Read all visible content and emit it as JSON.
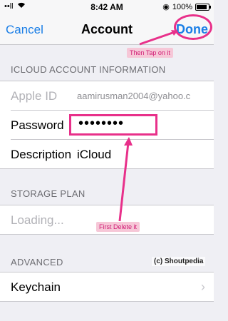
{
  "status": {
    "signal": "••ll",
    "time": "8:42 AM",
    "battery": "100%"
  },
  "nav": {
    "cancel": "Cancel",
    "title": "Account",
    "done": "Done"
  },
  "icloud": {
    "header": "ICLOUD ACCOUNT INFORMATION",
    "apple_id_label": "Apple ID",
    "apple_id_value": "aamirusman2004@yahoo.c",
    "password_label": "Password",
    "password_value": "••••••••",
    "description_label": "Description",
    "description_value": "iCloud"
  },
  "storage": {
    "header": "STORAGE PLAN",
    "loading": "Loading..."
  },
  "advanced": {
    "header": "ADVANCED",
    "keychain": "Keychain"
  },
  "annotations": {
    "then_tap": "Then Tap on it",
    "first_delete": "First Delete it",
    "watermark": "(c) Shoutpedia"
  },
  "colors": {
    "accent": "#1a7ee6",
    "highlight": "#e8308a"
  }
}
